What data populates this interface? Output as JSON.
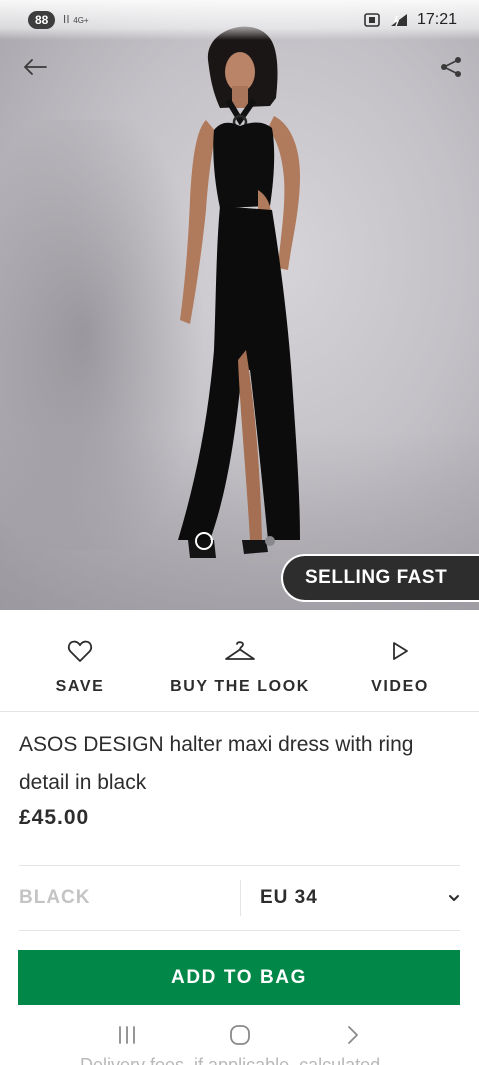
{
  "status_bar": {
    "battery": "88",
    "signal": "ll",
    "network": "4G+",
    "time": "17:21"
  },
  "gallery": {
    "badge": "SELLING FAST",
    "image_count": 2,
    "active_index": 0
  },
  "actions": [
    {
      "label": "SAVE",
      "icon": "heart-icon"
    },
    {
      "label": "BUY THE LOOK",
      "icon": "hanger-icon"
    },
    {
      "label": "VIDEO",
      "icon": "play-icon"
    }
  ],
  "product": {
    "title": "ASOS DESIGN halter maxi dress with ring detail in black",
    "price": "£45.00"
  },
  "selectors": {
    "colour": "BLACK",
    "size": "EU 34"
  },
  "add_to_bag_label": "ADD TO BAG",
  "delivery_note": "Delivery fees, if applicable, calculated",
  "colors": {
    "accent_green": "#018849",
    "badge_bg": "#2d2d2d",
    "text": "#2d2d2d"
  }
}
